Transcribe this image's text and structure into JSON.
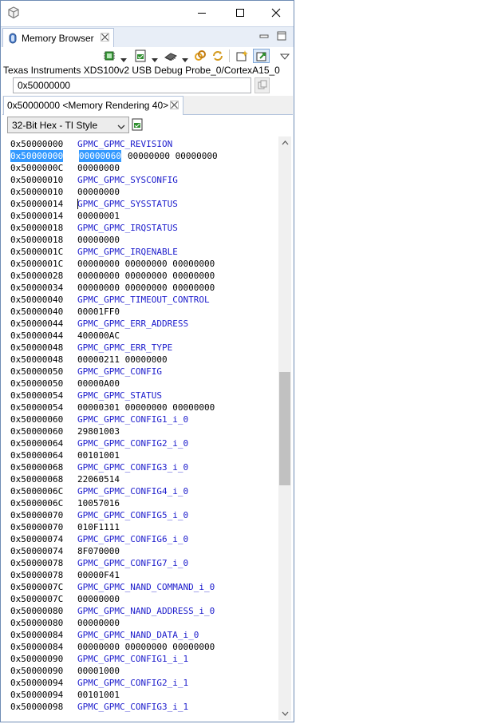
{
  "view": {
    "tab_label": "Memory Browser",
    "target_label": "Texas Instruments XDS100v2 USB Debug Probe_0/CortexA15_0",
    "address_input_value": "0x50000000",
    "rendering_tab_label": "0x50000000 <Memory Rendering 40>",
    "format_value": "32-Bit Hex - TI Style"
  },
  "icons": {
    "app": "app-cube-icon",
    "minimize": "minimize-icon",
    "maximize": "maximize-icon",
    "close": "close-icon",
    "view": "memory-browser-icon",
    "toolbar": [
      "new-memory-monitor-icon",
      "import-memory-icon",
      "save-memory-icon",
      "link-back-icon",
      "link-forward-icon",
      "new-rendering-icon",
      "pin-icon",
      "view-menu-icon"
    ]
  },
  "colors": {
    "register_name": "#1c1ccc",
    "selection": "#3399ff",
    "tab_bar": "#e8eef7"
  },
  "memory_rows": [
    {
      "addr": "0x50000000",
      "reg": "GPMC_GPMC_REVISION"
    },
    {
      "addr": "0x50000000",
      "v0": "00000060",
      "rest": "00000000 00000000",
      "selected": true
    },
    {
      "addr": "0x5000000C",
      "vals": "00000000"
    },
    {
      "addr": "0x50000010",
      "reg": "GPMC_GPMC_SYSCONFIG"
    },
    {
      "addr": "0x50000010",
      "vals": "00000000"
    },
    {
      "addr": "0x50000014",
      "reg": "GPMC_GPMC_SYSSTATUS",
      "caret": true
    },
    {
      "addr": "0x50000014",
      "vals": "00000001"
    },
    {
      "addr": "0x50000018",
      "reg": "GPMC_GPMC_IRQSTATUS"
    },
    {
      "addr": "0x50000018",
      "vals": "00000000"
    },
    {
      "addr": "0x5000001C",
      "reg": "GPMC_GPMC_IRQENABLE"
    },
    {
      "addr": "0x5000001C",
      "vals": "00000000 00000000 00000000"
    },
    {
      "addr": "0x50000028",
      "vals": "00000000 00000000 00000000"
    },
    {
      "addr": "0x50000034",
      "vals": "00000000 00000000 00000000"
    },
    {
      "addr": "0x50000040",
      "reg": "GPMC_GPMC_TIMEOUT_CONTROL"
    },
    {
      "addr": "0x50000040",
      "vals": "00001FF0"
    },
    {
      "addr": "0x50000044",
      "reg": "GPMC_GPMC_ERR_ADDRESS"
    },
    {
      "addr": "0x50000044",
      "vals": "400000AC"
    },
    {
      "addr": "0x50000048",
      "reg": "GPMC_GPMC_ERR_TYPE"
    },
    {
      "addr": "0x50000048",
      "vals": "00000211 00000000"
    },
    {
      "addr": "0x50000050",
      "reg": "GPMC_GPMC_CONFIG"
    },
    {
      "addr": "0x50000050",
      "vals": "00000A00"
    },
    {
      "addr": "0x50000054",
      "reg": "GPMC_GPMC_STATUS"
    },
    {
      "addr": "0x50000054",
      "vals": "00000301 00000000 00000000"
    },
    {
      "addr": "0x50000060",
      "reg": "GPMC_GPMC_CONFIG1_i_0"
    },
    {
      "addr": "0x50000060",
      "vals": "29801003"
    },
    {
      "addr": "0x50000064",
      "reg": "GPMC_GPMC_CONFIG2_i_0"
    },
    {
      "addr": "0x50000064",
      "vals": "00101001"
    },
    {
      "addr": "0x50000068",
      "reg": "GPMC_GPMC_CONFIG3_i_0"
    },
    {
      "addr": "0x50000068",
      "vals": "22060514"
    },
    {
      "addr": "0x5000006C",
      "reg": "GPMC_GPMC_CONFIG4_i_0"
    },
    {
      "addr": "0x5000006C",
      "vals": "10057016"
    },
    {
      "addr": "0x50000070",
      "reg": "GPMC_GPMC_CONFIG5_i_0"
    },
    {
      "addr": "0x50000070",
      "vals": "010F1111"
    },
    {
      "addr": "0x50000074",
      "reg": "GPMC_GPMC_CONFIG6_i_0"
    },
    {
      "addr": "0x50000074",
      "vals": "8F070000"
    },
    {
      "addr": "0x50000078",
      "reg": "GPMC_GPMC_CONFIG7_i_0"
    },
    {
      "addr": "0x50000078",
      "vals": "00000F41"
    },
    {
      "addr": "0x5000007C",
      "reg": "GPMC_GPMC_NAND_COMMAND_i_0"
    },
    {
      "addr": "0x5000007C",
      "vals": "00000000"
    },
    {
      "addr": "0x50000080",
      "reg": "GPMC_GPMC_NAND_ADDRESS_i_0"
    },
    {
      "addr": "0x50000080",
      "vals": "00000000"
    },
    {
      "addr": "0x50000084",
      "reg": "GPMC_GPMC_NAND_DATA_i_0"
    },
    {
      "addr": "0x50000084",
      "vals": "00000000 00000000 00000000"
    },
    {
      "addr": "0x50000090",
      "reg": "GPMC_GPMC_CONFIG1_i_1"
    },
    {
      "addr": "0x50000090",
      "vals": "00001000"
    },
    {
      "addr": "0x50000094",
      "reg": "GPMC_GPMC_CONFIG2_i_1"
    },
    {
      "addr": "0x50000094",
      "vals": "00101001"
    },
    {
      "addr": "0x50000098",
      "reg": "GPMC_GPMC_CONFIG3_i_1"
    }
  ]
}
